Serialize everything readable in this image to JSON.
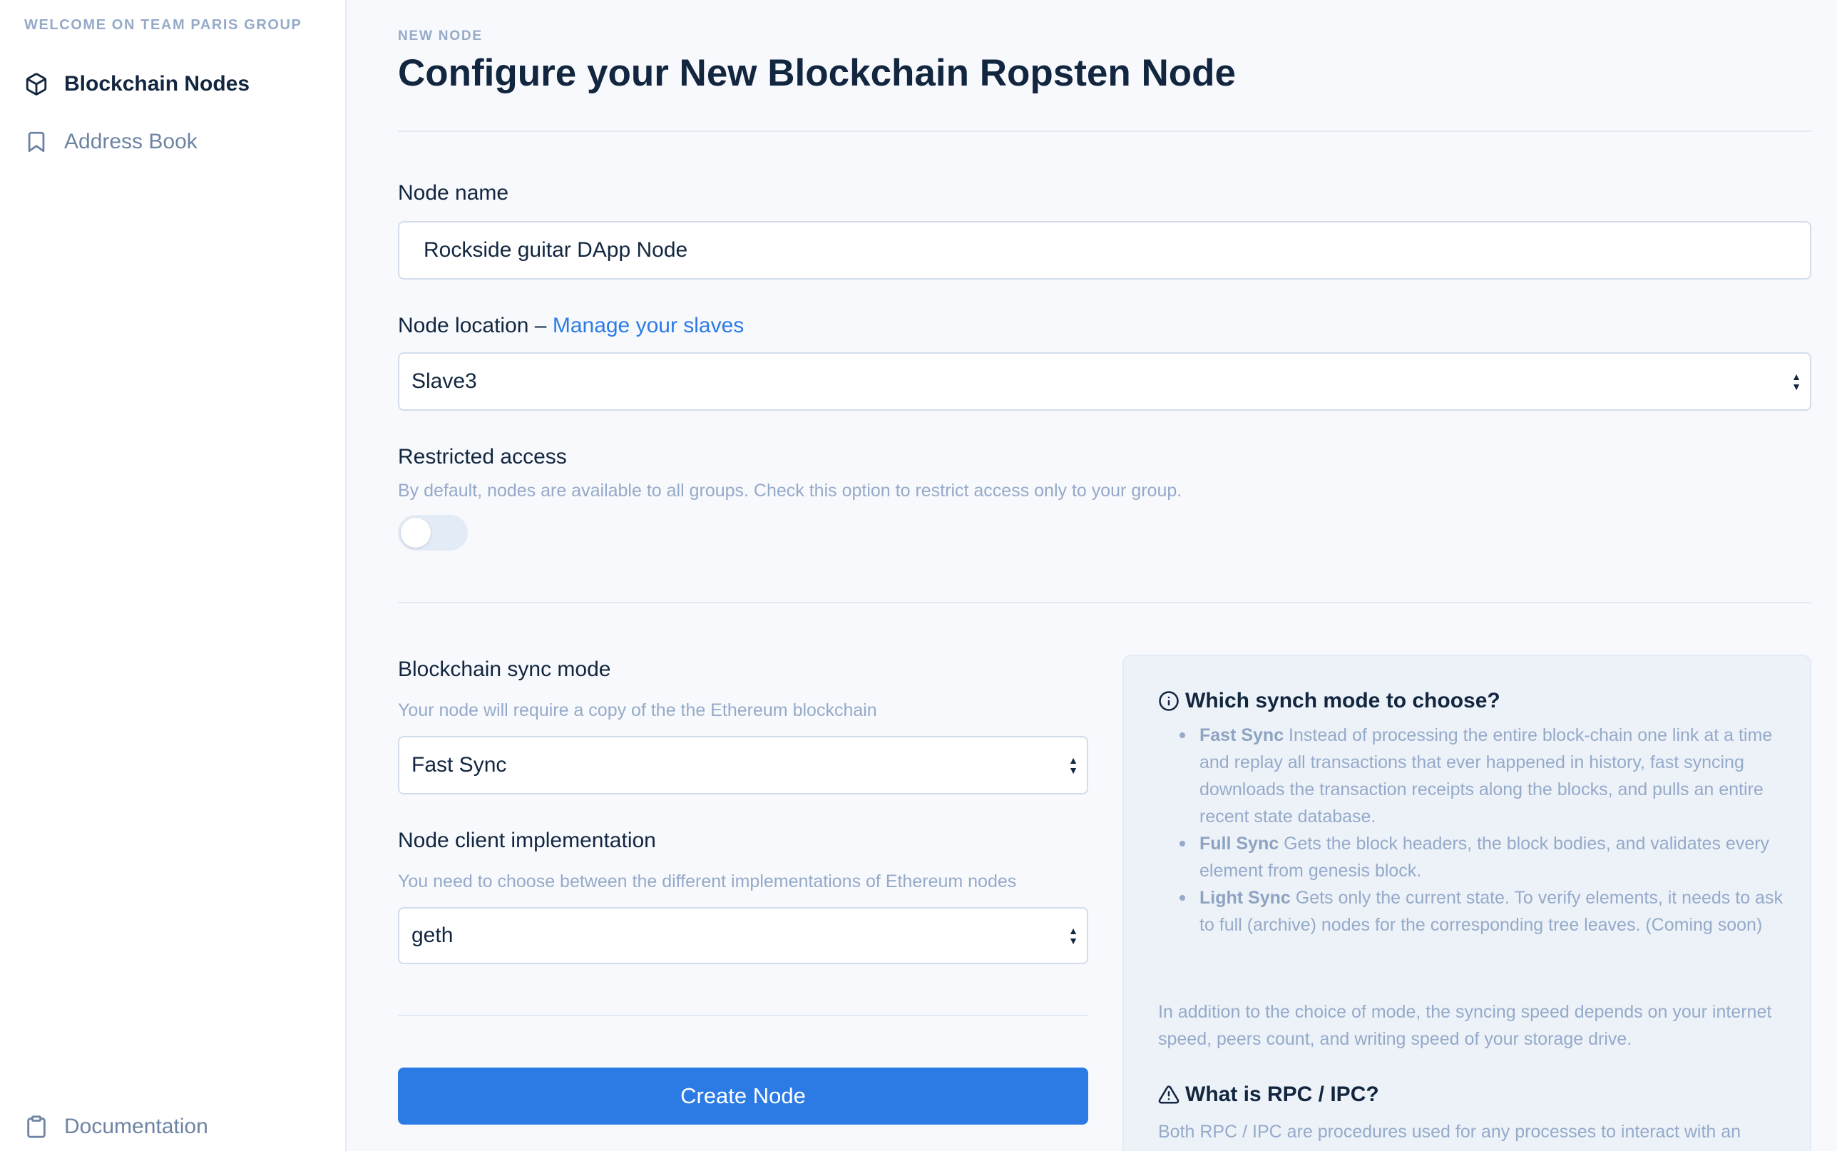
{
  "sidebar": {
    "welcome": "WELCOME ON TEAM PARIS GROUP",
    "items": [
      {
        "label": "Blockchain Nodes",
        "icon": "cube-icon",
        "active": true
      },
      {
        "label": "Address Book",
        "icon": "bookmark-icon",
        "active": false
      }
    ],
    "footer": {
      "label": "Documentation",
      "icon": "clipboard-icon"
    }
  },
  "header": {
    "pretitle": "NEW NODE",
    "title": "Configure your New Blockchain Ropsten Node"
  },
  "form": {
    "node_name": {
      "label": "Node name",
      "value": "Rockside guitar DApp Node"
    },
    "node_location": {
      "label": "Node location",
      "separator": " – ",
      "link": "Manage your slaves",
      "value": "Slave3"
    },
    "restricted_access": {
      "label": "Restricted access",
      "help": "By default, nodes are available to all groups. Check this option to restrict access only to your group.",
      "enabled": false
    },
    "sync_mode": {
      "label": "Blockchain sync mode",
      "help": "Your node will require a copy of the the Ethereum blockchain",
      "value": "Fast Sync"
    },
    "client": {
      "label": "Node client implementation",
      "help": "You need to choose between the different implementations of Ethereum nodes",
      "value": "geth"
    },
    "submit_label": "Create Node"
  },
  "info": {
    "title": "Which synch mode to choose?",
    "items": [
      {
        "term": "Fast Sync",
        "text": " Instead of processing the entire block-chain one link at a time and replay all transactions that ever happened in history, fast syncing downloads the transaction receipts along the blocks, and pulls an entire recent state database."
      },
      {
        "term": "Full Sync",
        "text": " Gets the block headers, the block bodies, and validates every element from genesis block."
      },
      {
        "term": "Light Sync",
        "text": " Gets only the current state. To verify elements, it needs to ask to full (archive) nodes for the corresponding tree leaves. (Coming soon)"
      }
    ],
    "note": "In addition to the choice of mode, the syncing speed depends on your internet speed, peers count, and writing speed of your storage drive.",
    "rpc_title": "What is RPC / IPC?",
    "rpc_text": "Both RPC / IPC are procedures used for any processes to interact with an"
  },
  "colors": {
    "accent": "#2c7be5",
    "text": "#12263f",
    "muted": "#95aac9",
    "background": "#f7f9fc",
    "border": "#d2ddec"
  }
}
